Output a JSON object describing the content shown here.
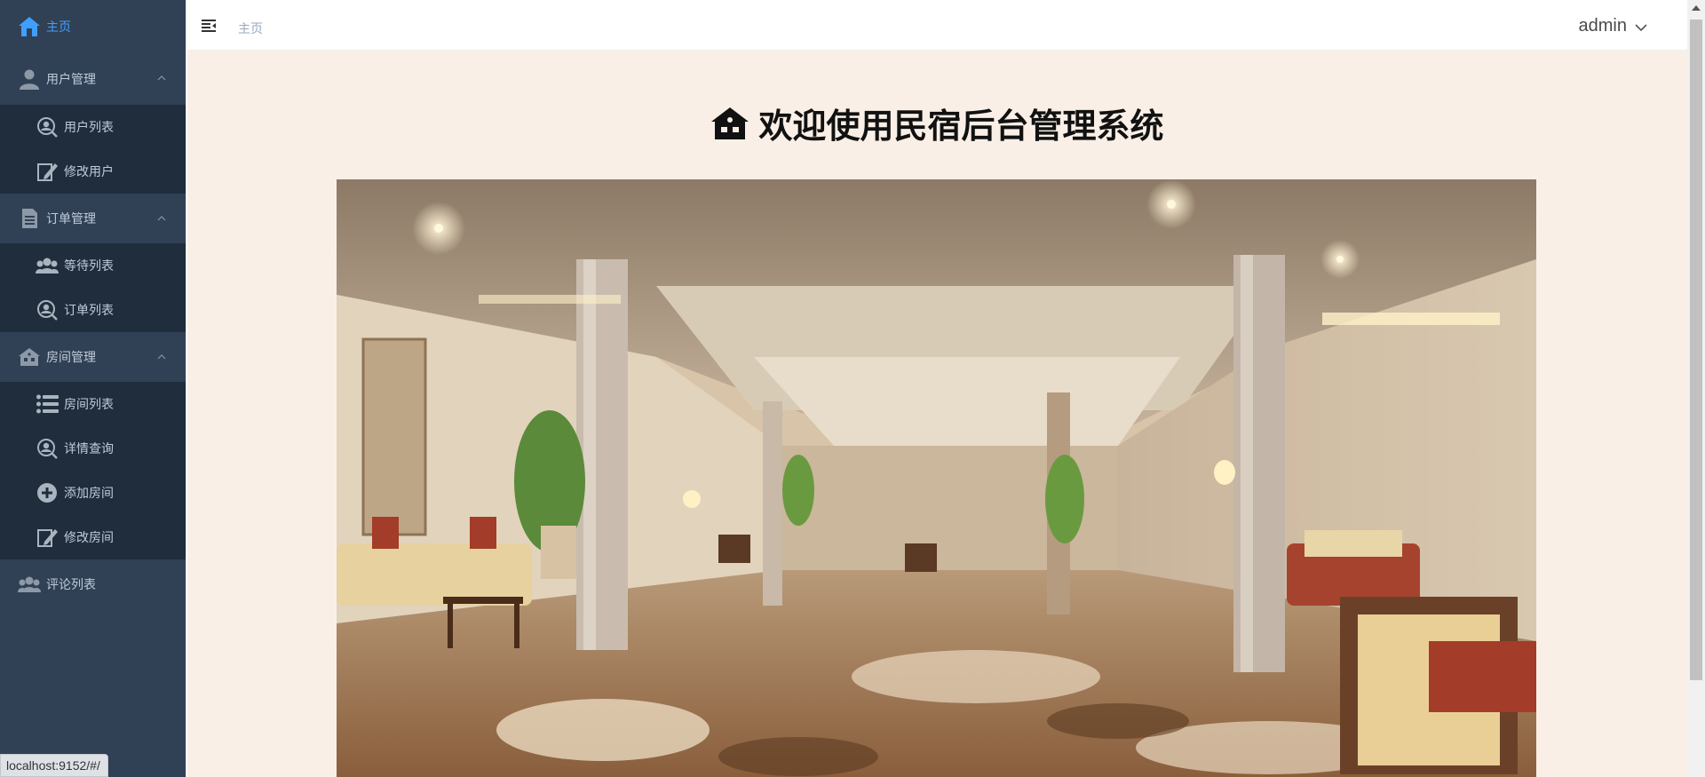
{
  "sidebar": {
    "home": {
      "label": "主页",
      "icon": "home-icon"
    },
    "groups": [
      {
        "title": "用户管理",
        "icon": "user-icon",
        "items": [
          {
            "label": "用户列表",
            "icon": "search-user-icon"
          },
          {
            "label": "修改用户",
            "icon": "edit-icon"
          }
        ]
      },
      {
        "title": "订单管理",
        "icon": "document-icon",
        "items": [
          {
            "label": "等待列表",
            "icon": "group-icon"
          },
          {
            "label": "订单列表",
            "icon": "search-user-icon"
          }
        ]
      },
      {
        "title": "房间管理",
        "icon": "house-icon",
        "items": [
          {
            "label": "房间列表",
            "icon": "list-icon"
          },
          {
            "label": "详情查询",
            "icon": "search-user-icon"
          },
          {
            "label": "添加房间",
            "icon": "add-icon"
          },
          {
            "label": "修改房间",
            "icon": "edit-icon"
          }
        ]
      }
    ],
    "comments": {
      "label": "评论列表",
      "icon": "group-icon"
    }
  },
  "navbar": {
    "breadcrumb": "主页",
    "user": "admin"
  },
  "main": {
    "welcome_title": "欢迎使用民宿后台管理系统"
  },
  "status_bar": {
    "url": "localhost:9152/#/"
  },
  "colors": {
    "sidebar_bg": "#304156",
    "submenu_bg": "#1f2d3d",
    "active": "#409eff",
    "content_bg": "#f9efe6"
  }
}
